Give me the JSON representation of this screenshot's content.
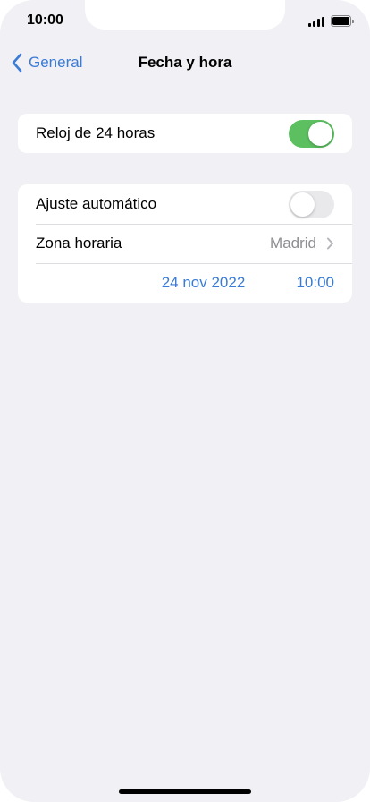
{
  "status_bar": {
    "time": "10:00"
  },
  "nav": {
    "back_label": "General",
    "title": "Fecha y hora"
  },
  "clock_group": {
    "label": "Reloj de 24 horas",
    "toggle_on": true
  },
  "settings_group": {
    "auto_label": "Ajuste automático",
    "auto_on": false,
    "timezone_label": "Zona horaria",
    "timezone_value": "Madrid",
    "date": "24 nov 2022",
    "time": "10:00"
  },
  "colors": {
    "accent": "#3a7bd5",
    "toggle_on": "#5cbf60",
    "background": "#f0f0f5"
  }
}
